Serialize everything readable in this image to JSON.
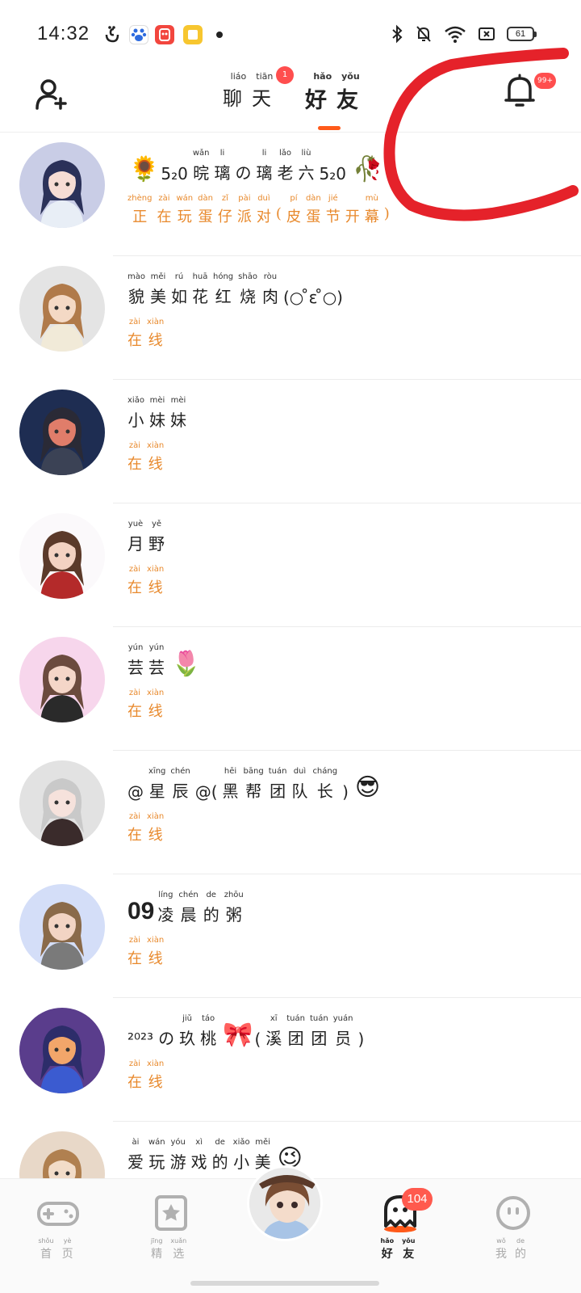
{
  "status_bar": {
    "time": "14:32",
    "battery": "61",
    "icons": [
      "uyghur-char-icon",
      "baidu-icon",
      "app-red-icon",
      "app-yellow-icon",
      "bluetooth-icon",
      "mute-icon",
      "wifi-icon",
      "sim-icon",
      "battery-icon"
    ]
  },
  "header": {
    "tabs": [
      {
        "chars": [
          {
            "p": "liáo",
            "h": "聊"
          },
          {
            "p": "tiān",
            "h": "天"
          }
        ],
        "badge": "1"
      },
      {
        "chars": [
          {
            "p": "hǎo",
            "h": "好"
          },
          {
            "p": "yǒu",
            "h": "友"
          }
        ]
      }
    ],
    "bell_badge": "99+"
  },
  "friends": [
    {
      "name": [
        {
          "e": "🌻"
        },
        {
          "t": "5₂0"
        },
        {
          "p": "wǎn",
          "h": "晥"
        },
        {
          "p": "li",
          "h": "璃"
        },
        {
          "p": "",
          "h": "の"
        },
        {
          "p": "li",
          "h": "璃"
        },
        {
          "p": "lǎo",
          "h": "老"
        },
        {
          "p": "liù",
          "h": "六"
        },
        {
          "t": "5₂0"
        },
        {
          "e": "🥀"
        }
      ],
      "status": [
        {
          "p": "zhèng",
          "h": "正"
        },
        {
          "p": "zài",
          "h": "在"
        },
        {
          "p": "wán",
          "h": "玩"
        },
        {
          "p": "dàn",
          "h": "蛋"
        },
        {
          "p": "zǐ",
          "h": "仔"
        },
        {
          "p": "pài",
          "h": "派"
        },
        {
          "p": "duì",
          "h": "对"
        },
        {
          "p": "",
          "h": "("
        },
        {
          "p": "pí",
          "h": "皮"
        },
        {
          "p": "dàn",
          "h": "蛋"
        },
        {
          "p": "jié",
          "h": "节"
        },
        {
          "p": "",
          "h": "开"
        },
        {
          "p": "mù",
          "h": "幕"
        },
        {
          "p": "",
          "h": ")"
        }
      ],
      "avatar": {
        "bg": "#c9cde6",
        "hair": "#2b3159",
        "skin": "#f6dcd4",
        "cloth": "#e8eef6"
      }
    },
    {
      "name": [
        {
          "p": "mào",
          "h": "貌"
        },
        {
          "p": "měi",
          "h": "美"
        },
        {
          "p": "rú",
          "h": "如"
        },
        {
          "p": "huā",
          "h": "花"
        },
        {
          "p": "hóng",
          "h": "红"
        },
        {
          "p": "shāo",
          "h": "烧"
        },
        {
          "p": "ròu",
          "h": "肉"
        },
        {
          "t": "(○ ̊ε ̊○)"
        }
      ],
      "status": [
        {
          "p": "zài",
          "h": "在"
        },
        {
          "p": "xiàn",
          "h": "线"
        }
      ],
      "avatar": {
        "bg": "#e4e4e4",
        "hair": "#b07a4a",
        "skin": "#f4d9c5",
        "cloth": "#f1ead8"
      }
    },
    {
      "name": [
        {
          "p": "xiǎo",
          "h": "小"
        },
        {
          "p": "mèi",
          "h": "妹"
        },
        {
          "p": "mèi",
          "h": "妹"
        }
      ],
      "status": [
        {
          "p": "zài",
          "h": "在"
        },
        {
          "p": "xiàn",
          "h": "线"
        }
      ],
      "avatar": {
        "bg": "#1e2d52",
        "hair": "#2a2a36",
        "skin": "#e07d6a",
        "cloth": "#3b4255"
      }
    },
    {
      "name": [
        {
          "p": "yuè",
          "h": "月"
        },
        {
          "p": "yě",
          "h": "野"
        }
      ],
      "status": [
        {
          "p": "zài",
          "h": "在"
        },
        {
          "p": "xiàn",
          "h": "线"
        }
      ],
      "avatar": {
        "bg": "#fbf9fb",
        "hair": "#5b3a2a",
        "skin": "#f3d2c2",
        "cloth": "#b42a2a"
      }
    },
    {
      "name": [
        {
          "p": "yún",
          "h": "芸"
        },
        {
          "p": "yún",
          "h": "芸"
        },
        {
          "e": "🌷"
        }
      ],
      "status": [
        {
          "p": "zài",
          "h": "在"
        },
        {
          "p": "xiàn",
          "h": "线"
        }
      ],
      "avatar": {
        "bg": "#f7d6ec",
        "hair": "#6b4b3e",
        "skin": "#f4d6c8",
        "cloth": "#2a2a2a"
      }
    },
    {
      "name": [
        {
          "t": "@"
        },
        {
          "p": "xīng",
          "h": "星"
        },
        {
          "p": "chén",
          "h": "辰"
        },
        {
          "t": "@("
        },
        {
          "p": "hēi",
          "h": "黑"
        },
        {
          "p": "bāng",
          "h": "帮"
        },
        {
          "p": "tuán",
          "h": "团"
        },
        {
          "p": "duì",
          "h": "队"
        },
        {
          "p": "cháng",
          "h": "长"
        },
        {
          "t": ")"
        },
        {
          "e": "😎"
        }
      ],
      "status": [
        {
          "p": "zài",
          "h": "在"
        },
        {
          "p": "xiàn",
          "h": "线"
        }
      ],
      "avatar": {
        "bg": "#e2e2e2",
        "hair": "#c9c9c9",
        "skin": "#f6e2dc",
        "cloth": "#3a2b2b"
      }
    },
    {
      "name": [
        {
          "n": "09"
        },
        {
          "p": "líng",
          "h": "凌"
        },
        {
          "p": "chén",
          "h": "晨"
        },
        {
          "p": "de",
          "h": "的"
        },
        {
          "p": "zhōu",
          "h": "粥"
        }
      ],
      "status": [
        {
          "p": "zài",
          "h": "在"
        },
        {
          "p": "xiàn",
          "h": "线"
        }
      ],
      "avatar": {
        "bg": "#d4def8",
        "hair": "#8a6a4a",
        "skin": "#f2d4c4",
        "cloth": "#7a7a7a"
      }
    },
    {
      "name": [
        {
          "t": "²⁰²³"
        },
        {
          "p": "",
          "h": "の"
        },
        {
          "p": "jiǔ",
          "h": "玖"
        },
        {
          "p": "táo",
          "h": "桃"
        },
        {
          "e": "🎀"
        },
        {
          "t": "("
        },
        {
          "p": "xī",
          "h": "溪"
        },
        {
          "p": "tuán",
          "h": "团"
        },
        {
          "p": "tuán",
          "h": "团"
        },
        {
          "p": "yuán",
          "h": "员"
        },
        {
          "t": ")"
        }
      ],
      "status": [
        {
          "p": "zài",
          "h": "在"
        },
        {
          "p": "xiàn",
          "h": "线"
        }
      ],
      "avatar": {
        "bg": "#5a3d8c",
        "hair": "#2d2d6a",
        "skin": "#f2a66a",
        "cloth": "#3b5bd0"
      }
    },
    {
      "name": [
        {
          "p": "ài",
          "h": "爱"
        },
        {
          "p": "wán",
          "h": "玩"
        },
        {
          "p": "yóu",
          "h": "游"
        },
        {
          "p": "xì",
          "h": "戏"
        },
        {
          "p": "de",
          "h": "的"
        },
        {
          "p": "xiǎo",
          "h": "小"
        },
        {
          "p": "měi",
          "h": "美"
        },
        {
          "e": "😉"
        }
      ],
      "status": [],
      "avatar": {
        "bg": "#e8d8c8",
        "hair": "#b08050",
        "skin": "#f2dcc8",
        "cloth": "#e8d8c8"
      }
    }
  ],
  "bottom_nav": [
    {
      "chars": [
        {
          "p": "shǒu",
          "h": "首"
        },
        {
          "p": "yè",
          "h": "页"
        }
      ],
      "icon": "gamepad-icon"
    },
    {
      "chars": [
        {
          "p": "jīng",
          "h": "精"
        },
        {
          "p": "xuǎn",
          "h": "选"
        }
      ],
      "icon": "star-card-icon"
    },
    {
      "chars": [
        {
          "p": "hǎo",
          "h": "好"
        },
        {
          "p": "yǒu",
          "h": "友"
        }
      ],
      "icon": "ghost-icon",
      "badge": "104"
    },
    {
      "chars": [
        {
          "p": "wǒ",
          "h": "我"
        },
        {
          "p": "de",
          "h": "的"
        }
      ],
      "icon": "smiley-icon"
    }
  ],
  "colors": {
    "accent": "#ff5a1a",
    "online": "#e8892c",
    "badge": "#ff4e4e",
    "annotation": "#e5222a"
  }
}
